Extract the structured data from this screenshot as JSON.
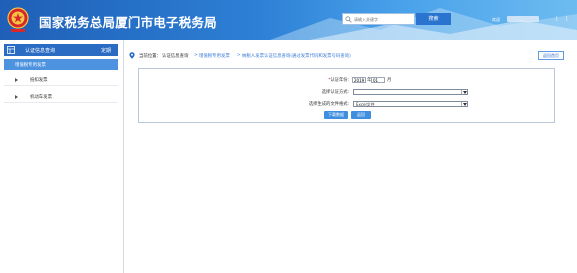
{
  "header": {
    "title": "国家税务总局厦门市电子税务局",
    "search_placeholder": "请输入关键字",
    "search_button": "搜索",
    "welcome": "欢迎",
    "sep_right": "|",
    "colors": {
      "header_start": "#1f5fb7",
      "header_end": "#6dbbf0"
    }
  },
  "sidebar": {
    "section_title": "认证信息查询",
    "section_right": "定期",
    "active_item": "增值税专用发票",
    "items": [
      {
        "label": "抵扣发票"
      },
      {
        "label": "机动车发票"
      }
    ]
  },
  "main": {
    "breadcrumb": {
      "label": "当前位置：",
      "items": [
        "认证信息查询",
        "增值税专用发票",
        "纳税人发票认证信息查询(通过发票代码和发票号码查询)"
      ]
    },
    "back_button": "返回首页",
    "form": {
      "period_label": "认证年份:",
      "year_value": "2019",
      "year_unit": "年",
      "month_value": "01",
      "month_unit": "月",
      "method_label": "选择认证方式:",
      "method_value": "",
      "format_label": "选择生成的文件格式:",
      "format_value": "Excel文件",
      "query_button": "下载数据",
      "reset_button": "返回"
    }
  }
}
